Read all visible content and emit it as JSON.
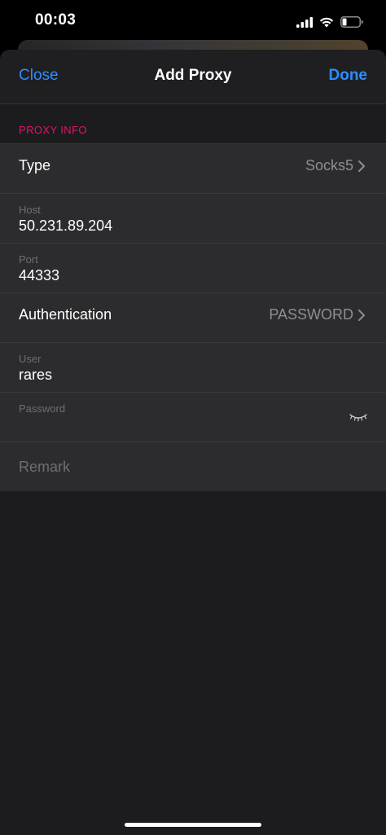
{
  "status_bar": {
    "time": "00:03",
    "icons": [
      "cellular-signal-icon",
      "wifi-icon",
      "battery-icon"
    ]
  },
  "nav": {
    "close_label": "Close",
    "title": "Add Proxy",
    "done_label": "Done"
  },
  "section": {
    "header": "PROXY INFO"
  },
  "form": {
    "type": {
      "label": "Type",
      "value": "Socks5"
    },
    "host": {
      "label": "Host",
      "value": "50.231.89.204"
    },
    "port": {
      "label": "Port",
      "value": "44333"
    },
    "authentication": {
      "label": "Authentication",
      "value": "PASSWORD"
    },
    "user": {
      "label": "User",
      "value": "rares"
    },
    "password": {
      "label": "Password",
      "value": ""
    },
    "remark": {
      "placeholder": "Remark"
    }
  },
  "colors": {
    "accent": "#2f8cff",
    "section_header": "#e0146e",
    "sheet_background": "#1c1c1e",
    "row_background": "#2c2c2e"
  }
}
